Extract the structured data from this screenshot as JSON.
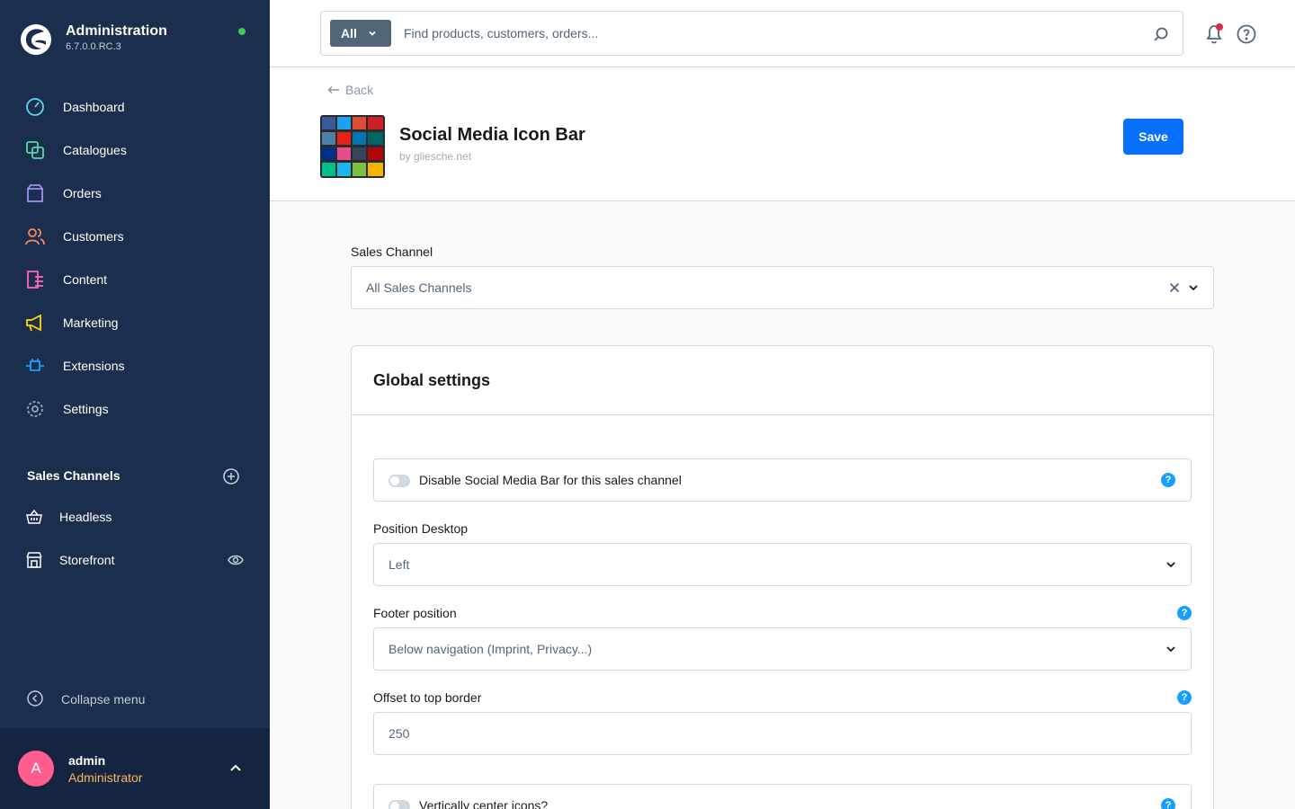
{
  "brand": {
    "title": "Administration",
    "version": "6.7.0.0.RC.3"
  },
  "nav": [
    {
      "label": "Dashboard",
      "color": "#57d9f0"
    },
    {
      "label": "Catalogues",
      "color": "#57d9a3"
    },
    {
      "label": "Orders",
      "color": "#a092f0"
    },
    {
      "label": "Customers",
      "color": "#f88962"
    },
    {
      "label": "Content",
      "color": "#ff68b4"
    },
    {
      "label": "Marketing",
      "color": "#ffd700"
    },
    {
      "label": "Extensions",
      "color": "#189eff"
    },
    {
      "label": "Settings",
      "color": "#9aa8b5"
    }
  ],
  "sales_channels": {
    "title": "Sales Channels",
    "items": [
      {
        "label": "Headless"
      },
      {
        "label": "Storefront"
      }
    ]
  },
  "collapse_label": "Collapse menu",
  "user": {
    "initial": "A",
    "name": "admin",
    "role": "Administrator"
  },
  "search": {
    "type": "All",
    "placeholder": "Find products, customers, orders..."
  },
  "back_label": "Back",
  "plugin": {
    "title": "Social Media Icon Bar",
    "by": "by gliesche.net"
  },
  "save_label": "Save",
  "sales_channel_field": {
    "label": "Sales Channel",
    "value": "All Sales Channels"
  },
  "card": {
    "title": "Global settings",
    "disable_toggle": "Disable Social Media Bar for this sales channel",
    "position_desktop": {
      "label": "Position Desktop",
      "value": "Left"
    },
    "footer_position": {
      "label": "Footer position",
      "value": "Below navigation (Imprint, Privacy...)"
    },
    "offset_top": {
      "label": "Offset to top border",
      "value": "250"
    },
    "vertical_center": "Vertically center icons?"
  },
  "help_glyph": "?",
  "colors": {
    "sidebar": "#1b2e4e",
    "accent": "#0870ff",
    "status": "#37d046"
  }
}
